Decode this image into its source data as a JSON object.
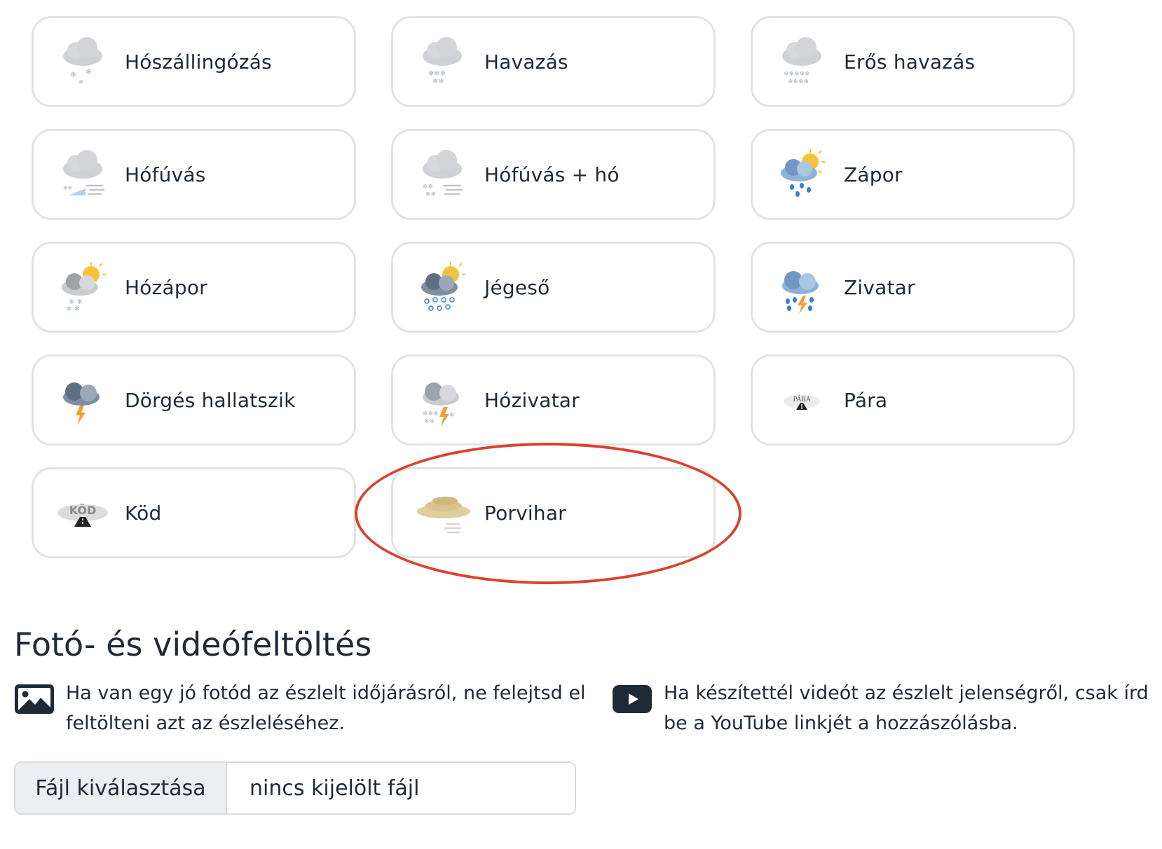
{
  "weather_options": [
    {
      "label": "Hószállingózás",
      "icon": "light-snow-icon"
    },
    {
      "label": "Havazás",
      "icon": "snow-icon"
    },
    {
      "label": "Erős havazás",
      "icon": "heavy-snow-icon"
    },
    {
      "label": "Hófúvás",
      "icon": "blowing-snow-icon"
    },
    {
      "label": "Hófúvás + hó",
      "icon": "blowing-snow-and-snow-icon"
    },
    {
      "label": "Zápor",
      "icon": "rain-shower-icon"
    },
    {
      "label": "Hózápor",
      "icon": "snow-shower-icon"
    },
    {
      "label": "Jégeső",
      "icon": "hail-icon"
    },
    {
      "label": "Zivatar",
      "icon": "thunderstorm-icon"
    },
    {
      "label": "Dörgés hallatszik",
      "icon": "thunder-icon"
    },
    {
      "label": "Hózivatar",
      "icon": "snow-thunderstorm-icon"
    },
    {
      "label": "Pára",
      "icon": "mist-icon",
      "icon_text": "PÁRA"
    },
    {
      "label": "Köd",
      "icon": "fog-icon",
      "icon_text": "KÖD"
    },
    {
      "label": "Porvihar",
      "icon": "dust-storm-icon"
    }
  ],
  "upload": {
    "title": "Fotó- és videófeltöltés",
    "photo_text": "Ha van egy jó fotód az észlelt időjárásról, ne felejtsd el feltölteni azt az észleléséhez.",
    "video_text": "Ha készítettél videót az észlelt jelenségről, csak írd be a YouTube linkjét a hozzászólásba.",
    "file_button": "Fájl kiválasztása",
    "file_status": "nincs kijelölt fájl"
  },
  "colors": {
    "text": "#1f2a37",
    "tile_border": "#e1e3e6",
    "highlight": "#d9432e",
    "cloud_light": "#c9cbce",
    "cloud_dark": "#5e6f82",
    "sun": "#f5c23a",
    "rain": "#3c7fc1",
    "lightning": "#f0a030",
    "dust": "#d8c48f"
  }
}
